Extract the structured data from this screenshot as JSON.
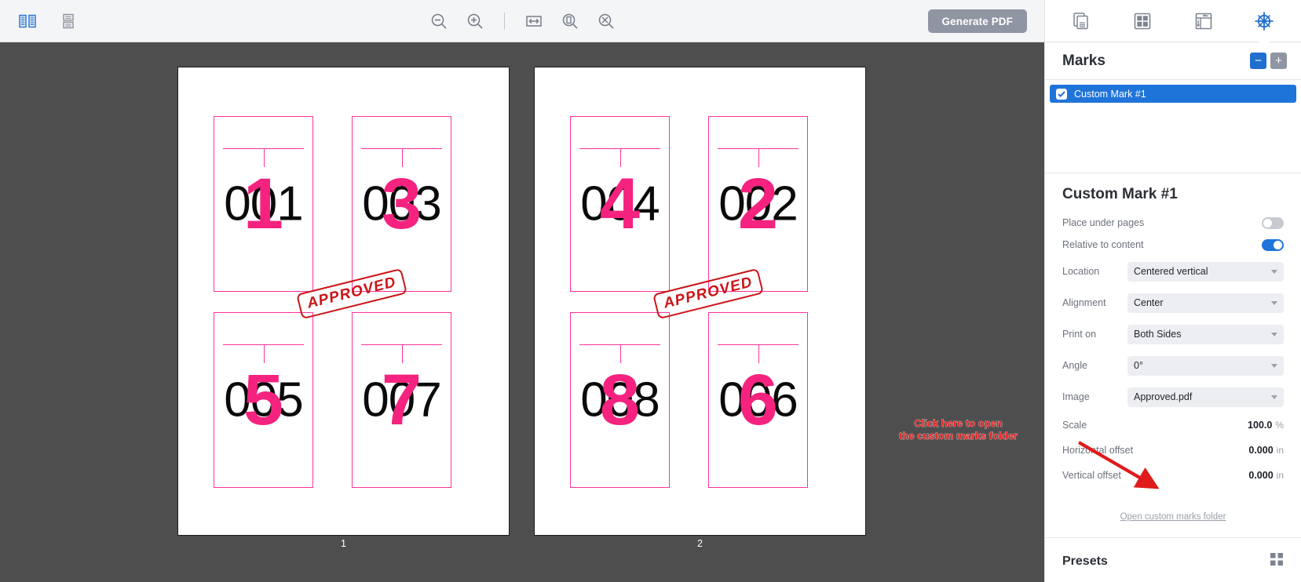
{
  "toolbar": {
    "left_icons": [
      {
        "name": "spread-view-icon",
        "label": "Spread view"
      },
      {
        "name": "single-page-view-icon",
        "label": "Single page view"
      }
    ],
    "center_icons": [
      {
        "name": "zoom-out-icon",
        "label": "Zoom out"
      },
      {
        "name": "zoom-in-icon",
        "label": "Zoom in"
      },
      {
        "name": "fit-width-icon",
        "label": "Fit width"
      },
      {
        "name": "fit-page-icon",
        "label": "Fit page"
      },
      {
        "name": "fit-all-icon",
        "label": "Fit all"
      }
    ],
    "generate_pdf_label": "Generate PDF"
  },
  "canvas": {
    "background": "#4e4e4e",
    "sheets": [
      {
        "label": "1",
        "cards": [
          {
            "black": "001",
            "pink": "1"
          },
          {
            "black": "003",
            "pink": "3"
          },
          {
            "black": "005",
            "pink": "5"
          },
          {
            "black": "007",
            "pink": "7"
          }
        ],
        "stamp_text": "APPROVED"
      },
      {
        "label": "2",
        "cards": [
          {
            "black": "004",
            "pink": "4"
          },
          {
            "black": "002",
            "pink": "2"
          },
          {
            "black": "008",
            "pink": "8"
          },
          {
            "black": "006",
            "pink": "6"
          }
        ],
        "stamp_text": "APPROVED"
      }
    ],
    "card_outline_color": "#ff3399",
    "pink_number_color": "#f5237f",
    "black_number_color": "#0a0a0a",
    "stamp_color": "#cc1417"
  },
  "right_panel": {
    "tabs": [
      {
        "name": "tab-pages",
        "icon": "pages-stack-icon",
        "active": false
      },
      {
        "name": "tab-layout",
        "icon": "grid-layout-icon",
        "active": false
      },
      {
        "name": "tab-imposition",
        "icon": "imposition-flow-icon",
        "active": false
      },
      {
        "name": "tab-marks",
        "icon": "registration-target-icon",
        "active": true
      }
    ],
    "marks_section": {
      "title": "Marks",
      "remove_label": "−",
      "add_label": "+",
      "accent": "#1f74d9",
      "items": [
        {
          "label": "Custom Mark #1",
          "checked": true,
          "selected": true
        }
      ]
    },
    "properties": {
      "title": "Custom Mark #1",
      "toggles": [
        {
          "label": "Place under pages",
          "on": false
        },
        {
          "label": "Relative to content",
          "on": true
        }
      ],
      "selects": [
        {
          "label": "Location",
          "value": "Centered vertical"
        },
        {
          "label": "Alignment",
          "value": "Center"
        },
        {
          "label": "Print on",
          "value": "Both Sides"
        },
        {
          "label": "Angle",
          "value": "0°"
        },
        {
          "label": "Image",
          "value": "Approved.pdf"
        }
      ],
      "values": [
        {
          "label": "Scale",
          "value": "100.0",
          "unit": "%"
        },
        {
          "label": "Horizontal offset",
          "value": "0.000",
          "unit": "in"
        },
        {
          "label": "Vertical offset",
          "value": "0.000",
          "unit": "in"
        }
      ],
      "open_folder_link": "Open custom marks folder"
    },
    "presets_section": {
      "title": "Presets",
      "icon": "preset-grid-icon"
    }
  },
  "annotation": {
    "line1": "Click here to open",
    "line2": "the custom marks folder",
    "color": "#e01b1b"
  }
}
